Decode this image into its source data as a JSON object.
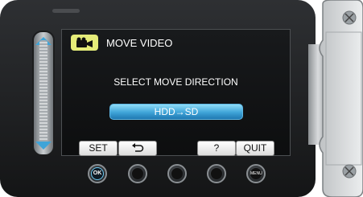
{
  "screen": {
    "title": "MOVE VIDEO",
    "title_icon": "video-camera-icon",
    "prompt": "SELECT MOVE DIRECTION",
    "direction_option": "HDD→SD"
  },
  "softkeys": {
    "set": "SET",
    "back_icon": "return-arrow-icon",
    "help": "?",
    "quit": "QUIT"
  },
  "hardware_buttons": {
    "ok": "OK",
    "menu": "MENU"
  },
  "colors": {
    "title_icon_bg": "#e5ec79",
    "selected_option": "#3fa4d8",
    "ok_ring": "#6bc7ef"
  }
}
